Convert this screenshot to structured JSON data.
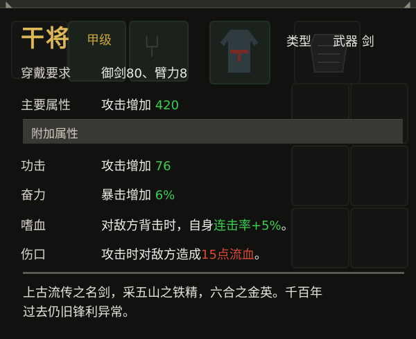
{
  "item": {
    "name": "干将",
    "grade": "甲级",
    "type_label": "类型",
    "type_value": "武器 剑"
  },
  "requirements": {
    "label": "穿戴要求",
    "value": "御剑80、臂力8"
  },
  "main_attribute": {
    "label": "主要属性",
    "text": "攻击增加",
    "value": "420"
  },
  "bonus_section": {
    "title": "附加属性"
  },
  "bonus_attributes": [
    {
      "label": "功击",
      "text": "攻击增加",
      "value": "76"
    },
    {
      "label": "奋力",
      "text": "暴击增加",
      "value": "6%"
    }
  ],
  "traits": [
    {
      "label": "嗜血",
      "prefix": "对敌方背击时，自身",
      "highlight": "连击率+5%",
      "suffix": "。"
    },
    {
      "label": "伤口",
      "prefix": "攻击时对敌方造成",
      "highlight": "15点流血",
      "suffix": "。"
    }
  ],
  "description": {
    "line1": "上古流传之名剑，采五山之铁精，六合之金英。千百年",
    "line2": "过去仍旧锋利异常。"
  },
  "colors": {
    "gold": "#dcb85a",
    "green": "#3ecb52",
    "red": "#d94a3a"
  }
}
